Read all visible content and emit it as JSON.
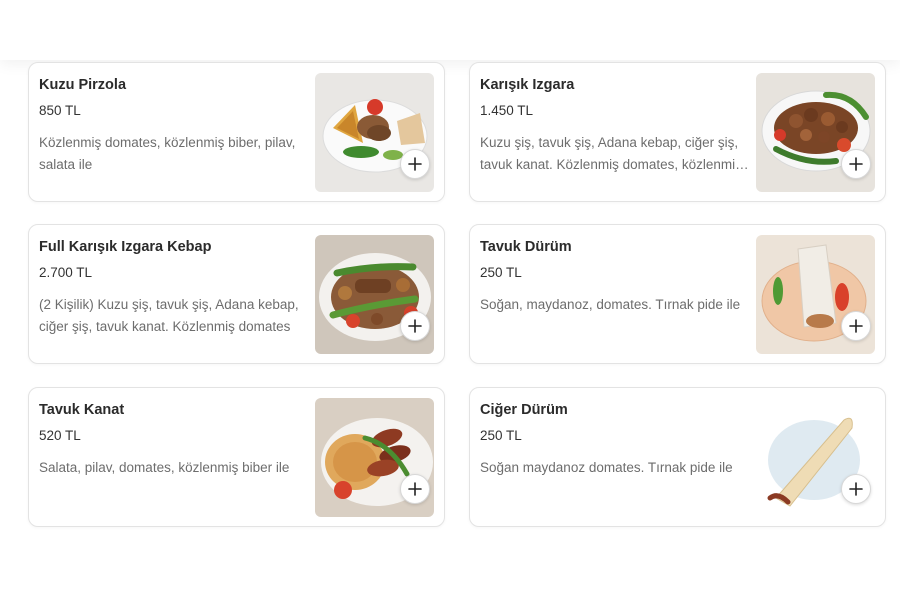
{
  "menu": {
    "items": [
      {
        "name": "Kuzu Pirzola",
        "price": "850 TL",
        "description": "Közlenmiş domates, közlenmiş biber, pilav, salata ile",
        "image_icon": "lamb-chops-plate-photo"
      },
      {
        "name": "Karışık Izgara",
        "price": "1.450 TL",
        "description": "Kuzu şiş, tavuk şiş, Adana kebap, ciğer şiş, tavuk kanat. Közlenmiş domates, közlenmiş biber",
        "image_icon": "mixed-grill-plate-photo"
      },
      {
        "name": "Full Karışık Izgara Kebap",
        "price": "2.700 TL",
        "description": "(2 Kişilik) Kuzu şiş, tavuk şiş, Adana kebap, ciğer şiş, tavuk kanat. Közlenmiş domates",
        "image_icon": "full-mixed-grill-platter-photo"
      },
      {
        "name": "Tavuk Dürüm",
        "price": "250 TL",
        "description": "Soğan, maydanoz, domates. Tırnak pide ile",
        "image_icon": "chicken-wrap-photo"
      },
      {
        "name": "Tavuk Kanat",
        "price": "520 TL",
        "description": "Salata, pilav, domates, közlenmiş biber ile",
        "image_icon": "chicken-wings-photo"
      },
      {
        "name": "Ciğer Dürüm",
        "price": "250 TL",
        "description": "Soğan maydanoz domates. Tırnak pide ile",
        "image_icon": "liver-wrap-photo"
      }
    ],
    "add_icon": "plus-icon"
  }
}
